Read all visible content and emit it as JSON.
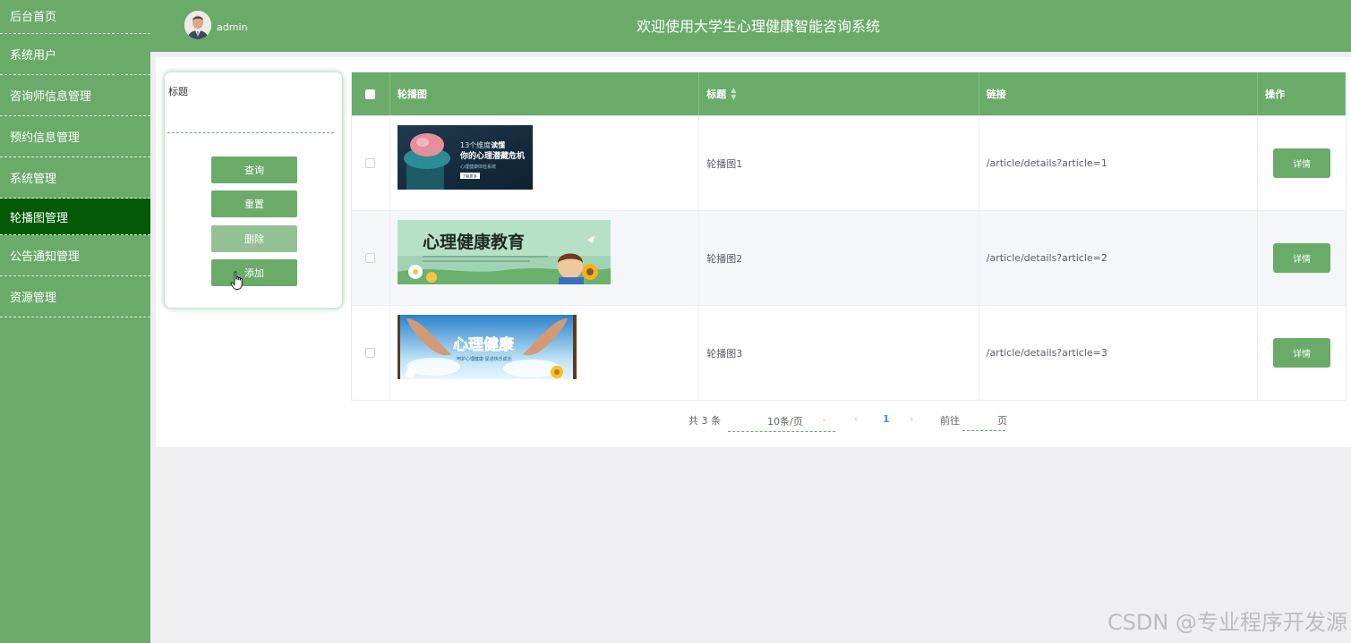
{
  "sidebar": {
    "items": [
      {
        "label": "后台首页"
      },
      {
        "label": "系统用户"
      },
      {
        "label": "咨询师信息管理"
      },
      {
        "label": "预约信息管理"
      },
      {
        "label": "系统管理"
      },
      {
        "label": "轮播图管理"
      },
      {
        "label": "公告通知管理"
      },
      {
        "label": "资源管理"
      }
    ],
    "active": "轮播图管理"
  },
  "header": {
    "username": "admin",
    "title": "欢迎使用大学生心理健康智能咨询系统"
  },
  "search": {
    "label": "标题",
    "value": "",
    "buttons": {
      "query": "查询",
      "reset": "重置",
      "delete": "删除",
      "add": "添加"
    }
  },
  "table": {
    "columns": [
      "轮播图",
      "标题",
      "链接",
      "操作"
    ],
    "rows": [
      {
        "title": "轮播图1",
        "link": "/article/details?article=1",
        "action": "详情",
        "banner": {
          "line1a": "13个维度",
          "line1b": "读懂",
          "line2": "你的心理潜藏危机",
          "line3": "心理健康体检系统",
          "button": "了解更多"
        }
      },
      {
        "title": "轮播图2",
        "link": "/article/details?article=2",
        "action": "详情",
        "banner": {
          "heading": "心理健康教育"
        }
      },
      {
        "title": "轮播图3",
        "link": "/article/details?article=3",
        "action": "详情",
        "banner": {
          "heading": "心理健康",
          "sub": "呵护心理健康 促进快乐成长"
        }
      }
    ]
  },
  "pagination": {
    "total_text": "共 3 条",
    "page_size": "10条/页",
    "current_page": "1",
    "goto_label": "前往",
    "page_suffix": "页",
    "prev_icon": "chevron-left-icon",
    "next_icon": "chevron-right-icon"
  },
  "watermark": "CSDN @专业程序开发源",
  "colors": {
    "primary": "#6aab6a",
    "sidebar_active": "#045a04",
    "page_bg": "#eeeef3"
  }
}
